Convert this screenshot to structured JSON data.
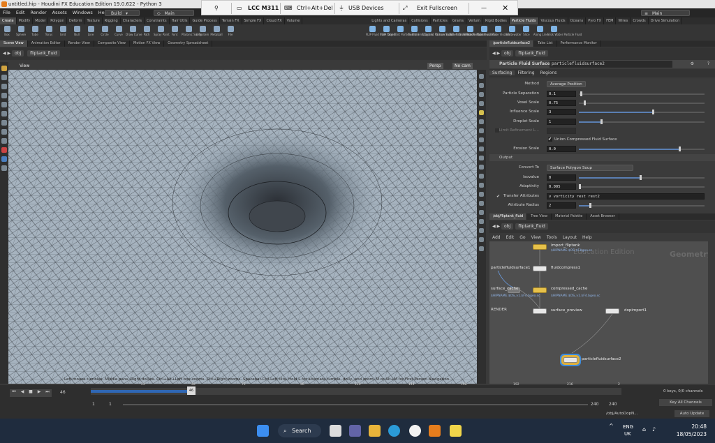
{
  "window_title": "untitled.hip - Houdini FX Education Edition 19.0.622 - Python 3",
  "menu": [
    "File",
    "Edit",
    "Render",
    "Assets",
    "Windows",
    "Help"
  ],
  "build_label": "Build",
  "desktop_left": "Main",
  "desktop_right": "Main",
  "remote_bar": {
    "host": "LCC M311",
    "keys": "Ctrl+Alt+Del",
    "usb": "USB Devices",
    "fullscreen": "Exit Fullscreen"
  },
  "shelf_tabs_left": [
    "Create",
    "Modify",
    "Model",
    "Polygon",
    "Deform",
    "Texture",
    "Rigging",
    "Characters",
    "Constraints",
    "Hair Utils",
    "Guide Process",
    "Terrain FX",
    "Simple FX",
    "Cloud FX",
    "Volume"
  ],
  "shelf_tabs_right": [
    "Lights and Cameras",
    "Collisions",
    "Particles",
    "Grains",
    "Vellum",
    "Rigid Bodies",
    "Particle Fluids",
    "Viscous Fluids",
    "Oceans",
    "Pyro FX",
    "FEM",
    "Wires",
    "Crowds",
    "Drive Simulation"
  ],
  "shelf_tools_left": [
    "Box",
    "Sphere",
    "Tube",
    "Torus",
    "Grid",
    "Null",
    "Line",
    "Circle",
    "Curve",
    "Draw Curve",
    "Path",
    "Spray Paint",
    "Font",
    "Platonic Solids",
    "L-System",
    "Metaball",
    "File"
  ],
  "shelf_tools_right": [
    "FLIP Fluid from Object",
    "FLIP Tank",
    "Emit Particle Fluid",
    "Fluid from Objects",
    "Sculpted Particle Fluid",
    "Ocean Splash Particle Fluid",
    "Wave Tank Particle Fluid",
    "Sluice Particle Fluid",
    "Condensation",
    "Make Viscous",
    "Whitewater",
    "Slice",
    "Along Line",
    "Slick Water Particle Fluid"
  ],
  "left_pane_tabs": [
    "Scene View",
    "Animation Editor",
    "Render View",
    "Composite View",
    "Motion FX View",
    "Geometry Spreadsheet"
  ],
  "right_top_tabs": [
    "/particlefluidsurface2",
    "Take List",
    "Performance Monitor"
  ],
  "right_bottom_tabs": [
    "/obj/fliptank_fluid",
    "Tree View",
    "Material Palette",
    "Asset Browser"
  ],
  "path": {
    "root": "obj",
    "node": "fliptank_fluid"
  },
  "viewport": {
    "label": "View",
    "persp": "Persp",
    "cam": "No cam",
    "hint": "Left mouse tumbles. Middle pans. Right dollies. Ctrl+Alt+Left box-zooms. Ctrl+Right zooms. Spacebar-Ctrl-Left tilts. Hold L for alternate tumble, dolly, and zoom.    M or Alt+M for First Person Navigation."
  },
  "parm_header": {
    "type": "Particle Fluid Surface",
    "name": "particlefluidsurface2"
  },
  "parm_tabs": [
    "Surfacing",
    "Filtering",
    "Regions"
  ],
  "params": [
    {
      "label": "Method",
      "menu": "Average Position"
    },
    {
      "label": "Particle Separation",
      "value": "0.1",
      "frac": 0.0
    },
    {
      "label": "Voxel Scale",
      "value": "0.75",
      "frac": 0.04
    },
    {
      "label": "Influence Scale",
      "value": "3",
      "frac": 0.6
    },
    {
      "label": "Droplet Scale",
      "value": "1",
      "frac": 0.2
    },
    {
      "label": "Limit Refinement L...",
      "value": "",
      "frac": null
    },
    {
      "label": "Union Compressed Fluid Surface",
      "check": true
    },
    {
      "label": "Erosion Scale",
      "value": "0.0",
      "frac": 0.9
    }
  ],
  "output_section": "Output",
  "output_params": [
    {
      "label": "Convert To",
      "menu": "Surface Polygon Soup"
    },
    {
      "label": "Isovalue",
      "value": "0",
      "frac": 0.5
    },
    {
      "label": "Adaptivity",
      "value": "0.005",
      "frac": 0.0
    },
    {
      "label": "Transfer Attributes",
      "value": "v vorticity rest rest2"
    },
    {
      "label": "Attribute Radius",
      "value": "2",
      "frac": 0.1
    }
  ],
  "net_menu": [
    "Add",
    "Edit",
    "Go",
    "View",
    "Tools",
    "Layout",
    "Help"
  ],
  "net_watermark": {
    "edition": "Education Edition",
    "context": "Geometry"
  },
  "nodes": [
    {
      "name": "import_fliptank",
      "sub": "$HIPNAME.$OS.$F.bgeo.sc"
    },
    {
      "name": "fluidcompress1",
      "sub": ""
    },
    {
      "name": "particlefluidsurface1",
      "sub": ""
    },
    {
      "name": "compressed_cache",
      "sub": "$HIPNAME.$OS_v1.$F4.bgeo.sc"
    },
    {
      "name": "surface_cache",
      "sub": "$HIPNAME.$OS_v1.$F4.bgeo.sc"
    },
    {
      "name": "surface_preview",
      "sub": ""
    },
    {
      "name": "dopimport1",
      "sub": ""
    },
    {
      "name": "particlefluidsurface2",
      "sub": ""
    }
  ],
  "render_label": "RENDER",
  "timeline": {
    "frame": "46",
    "start": "1",
    "start2": "1",
    "end": "240",
    "end2": "240",
    "ticks": [
      "24",
      "48",
      "72",
      "96",
      "120",
      "144",
      "168",
      "192",
      "216",
      "2"
    ]
  },
  "keys_label": "0 keys, 0/0 channels",
  "key_all": "Key All Channels",
  "status_path": "/obj/AutoDopN...",
  "auto_update": "Auto Update",
  "taskbar": {
    "search": "Search",
    "lang": "ENG",
    "region": "UK",
    "time": "20:48",
    "date": "18/05/2023"
  }
}
